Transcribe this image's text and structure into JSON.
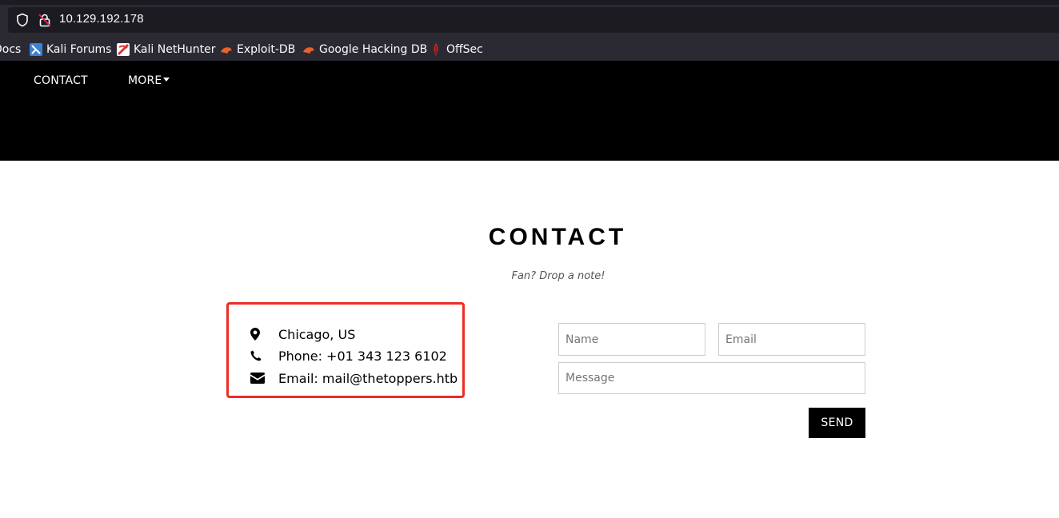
{
  "browser": {
    "url": "10.129.192.178",
    "bookmarks": [
      {
        "label": "Docs",
        "icon": "bookmark-icon"
      },
      {
        "label": "Kali Forums",
        "icon": "kali-forums-icon"
      },
      {
        "label": "Kali NetHunter",
        "icon": "kali-nethunter-icon"
      },
      {
        "label": "Exploit-DB",
        "icon": "exploit-db-icon"
      },
      {
        "label": "Google Hacking DB",
        "icon": "ghdb-icon"
      },
      {
        "label": "OffSec",
        "icon": "offsec-icon"
      }
    ]
  },
  "nav": {
    "items": [
      {
        "label": "CONTACT"
      },
      {
        "label": "MORE",
        "icon": "caret-down-icon"
      }
    ]
  },
  "contact": {
    "title": "CONTACT",
    "subtitle": "Fan? Drop a note!",
    "info": [
      {
        "icon": "map-marker-icon",
        "text": "Chicago, US"
      },
      {
        "icon": "phone-icon",
        "text": "Phone: +01 343 123 6102"
      },
      {
        "icon": "envelope-icon",
        "text": "Email: mail@thetoppers.htb"
      }
    ],
    "form": {
      "name_placeholder": "Name",
      "email_placeholder": "Email",
      "message_placeholder": "Message",
      "send_label": "SEND"
    },
    "highlight_color": "#ee2b24"
  }
}
